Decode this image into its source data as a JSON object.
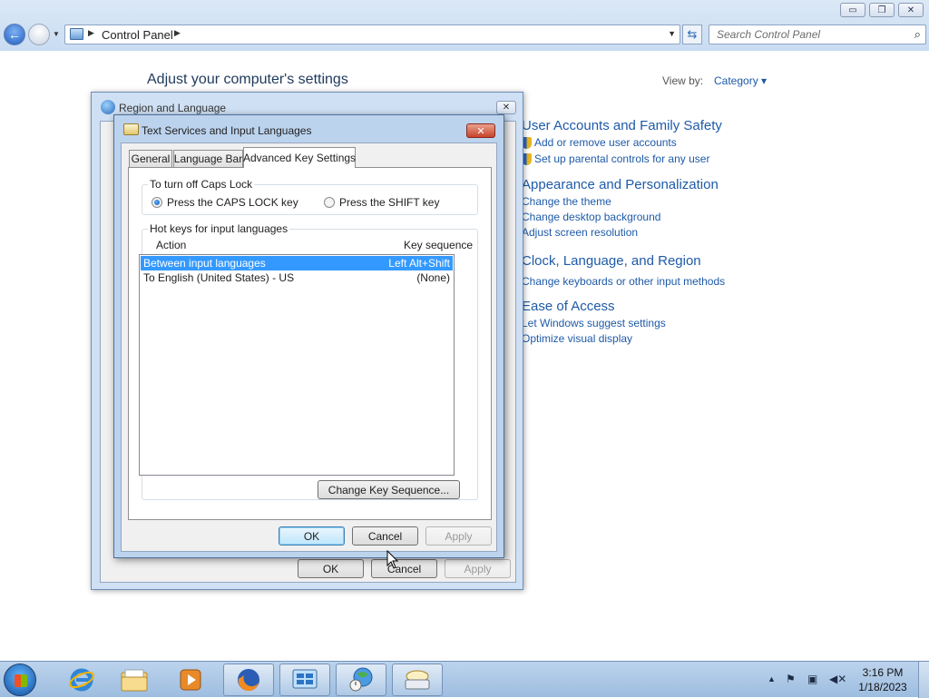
{
  "window": {
    "minimize_glyph": "▭",
    "maximize_glyph": "❐",
    "close_glyph": "✕"
  },
  "explorer": {
    "breadcrumb": "Control Panel",
    "search_placeholder": "Search Control Panel"
  },
  "control_panel": {
    "heading": "Adjust your computer's settings",
    "view_by_label": "View by:",
    "view_by_value": "Category ▾",
    "categories": [
      {
        "title": "User Accounts and Family Safety",
        "links": [
          "Add or remove user accounts",
          "Set up parental controls for any user"
        ]
      },
      {
        "title": "Appearance and Personalization",
        "links": [
          "Change the theme",
          "Change desktop background",
          "Adjust screen resolution"
        ]
      },
      {
        "title": "Clock, Language, and Region",
        "links": [
          "Change keyboards or other input methods"
        ]
      },
      {
        "title": "Ease of Access",
        "links": [
          "Let Windows suggest settings",
          "Optimize visual display"
        ]
      }
    ]
  },
  "region_dialog": {
    "title": "Region and Language",
    "buttons": {
      "ok": "OK",
      "cancel": "Cancel",
      "apply": "Apply"
    }
  },
  "text_services_dialog": {
    "title": "Text Services and Input Languages",
    "tabs": [
      "General",
      "Language Bar",
      "Advanced Key Settings"
    ],
    "active_tab": "Advanced Key Settings",
    "caps_lock_group": {
      "legend": "To turn off Caps Lock",
      "options": [
        "Press the CAPS LOCK key",
        "Press the SHIFT key"
      ],
      "selected": "Press the CAPS LOCK key"
    },
    "hotkeys_group": {
      "legend": "Hot keys for input languages",
      "columns": {
        "action": "Action",
        "key_sequence": "Key sequence"
      },
      "rows": [
        {
          "action": "Between input languages",
          "keys": "Left Alt+Shift",
          "selected": true
        },
        {
          "action": "To English (United States) - US",
          "keys": "(None)",
          "selected": false
        }
      ],
      "change_button": "Change Key Sequence..."
    },
    "buttons": {
      "ok": "OK",
      "cancel": "Cancel",
      "apply": "Apply"
    }
  },
  "taskbar": {
    "apps": [
      "internet-explorer",
      "windows-explorer",
      "media-player",
      "firefox",
      "control-panel",
      "region-and-language",
      "text-services"
    ],
    "clock_time": "3:16 PM",
    "clock_date": "1/18/2023"
  },
  "colors": {
    "link": "#1e5aa8",
    "selection": "#3399ff",
    "dialog_frame": "#bcd3ee"
  }
}
